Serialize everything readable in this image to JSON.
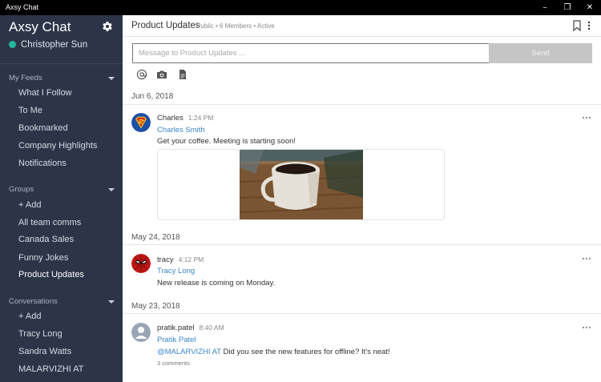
{
  "window": {
    "title": "Axsy Chat"
  },
  "sidebar": {
    "app_title": "Axsy Chat",
    "user_name": "Christopher Sun",
    "sections": [
      {
        "header": "My Feeds",
        "items": [
          "What I Follow",
          "To Me",
          "Bookmarked",
          "Company Highlights",
          "Notifications"
        ]
      },
      {
        "header": "Groups",
        "items": [
          "+ Add",
          "All team comms",
          "Canada Sales",
          "Funny Jokes",
          "Product Updates"
        ]
      },
      {
        "header": "Conversations",
        "items": [
          "+ Add",
          "Tracy Long",
          "Sandra Watts",
          "MALARVIZHI AT"
        ]
      }
    ],
    "active_item": "Product Updates"
  },
  "header": {
    "title": "Product Updates",
    "meta": "Public • 6 Members • Active"
  },
  "composer": {
    "placeholder": "Message to Product Updates ...",
    "send_label": "Send"
  },
  "feed": [
    {
      "date": "Jun 6, 2018",
      "author": "Charles",
      "time": "1:24 PM",
      "full_name": "Charles Smith",
      "body": "Get your coffee. Meeting is starting soon!"
    },
    {
      "date": "May 24, 2018",
      "author": "tracy",
      "time": "4:12 PM",
      "full_name": "Tracy Long",
      "body": "New release is coming on Monday."
    },
    {
      "date": "May 23, 2018",
      "author": "pratik.patel",
      "time": "8:40 AM",
      "full_name": "Pratik Patel",
      "mention": "@MALARVIZHI AT",
      "body": " Did you see the new features for offline? It's neat!",
      "comments": "3 comments"
    }
  ],
  "colors": {
    "sidebar_bg": "#2c3548",
    "status_online": "#22b8a0",
    "link": "#3b87c9",
    "send_button": "#c5c5c5"
  }
}
